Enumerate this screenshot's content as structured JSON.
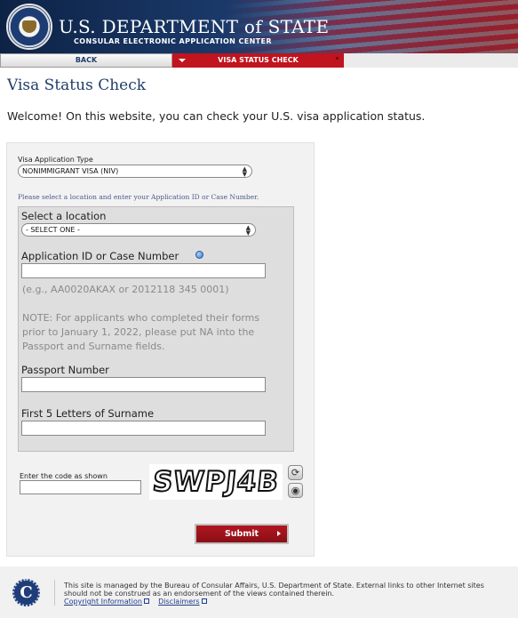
{
  "header": {
    "title": "U.S. DEPARTMENT of STATE",
    "subtitle": "CONSULAR ELECTRONIC APPLICATION CENTER",
    "seal_icon": "department-of-state-seal-icon"
  },
  "nav": {
    "back_label": "BACK",
    "current_label": "VISA STATUS CHECK"
  },
  "page": {
    "title": "Visa Status Check",
    "welcome": "Welcome! On this website, you can check your U.S. visa application status."
  },
  "form": {
    "visa_type_label": "Visa Application Type",
    "visa_type_value": "NONIMMIGRANT VISA (NIV)",
    "hint": "Please select a location and enter your Application ID or Case Number.",
    "location_label": "Select a location",
    "location_value": "- SELECT ONE -",
    "app_id_label": "Application ID or Case Number",
    "app_id_value": "",
    "app_id_example": "(e.g., AA0020AKAX or 2012118 345 0001)",
    "note_line1": "NOTE: For applicants who completed their forms",
    "note_line2": "prior to January 1, 2022, please put NA into the",
    "note_line3": "Passport and Surname fields.",
    "passport_label": "Passport Number",
    "passport_value": "",
    "surname_label": "First 5 Letters of Surname",
    "surname_value": "",
    "code_label": "Enter the code as shown",
    "code_value": "",
    "captcha_text": "SWPJ4B",
    "submit_label": "Submit"
  },
  "footer": {
    "text": "This site is managed by the Bureau of Consular Affairs, U.S. Department of State. External links to other Internet sites should not be construed as an endorsement of the views contained therein.",
    "link_copyright": "Copyright Information",
    "link_disclaimers": "Disclaimers",
    "logo_letter": "C"
  },
  "colors": {
    "brand_navy": "#1f3d6b",
    "brand_red": "#c0141e",
    "submit_red": "#9f121b"
  }
}
